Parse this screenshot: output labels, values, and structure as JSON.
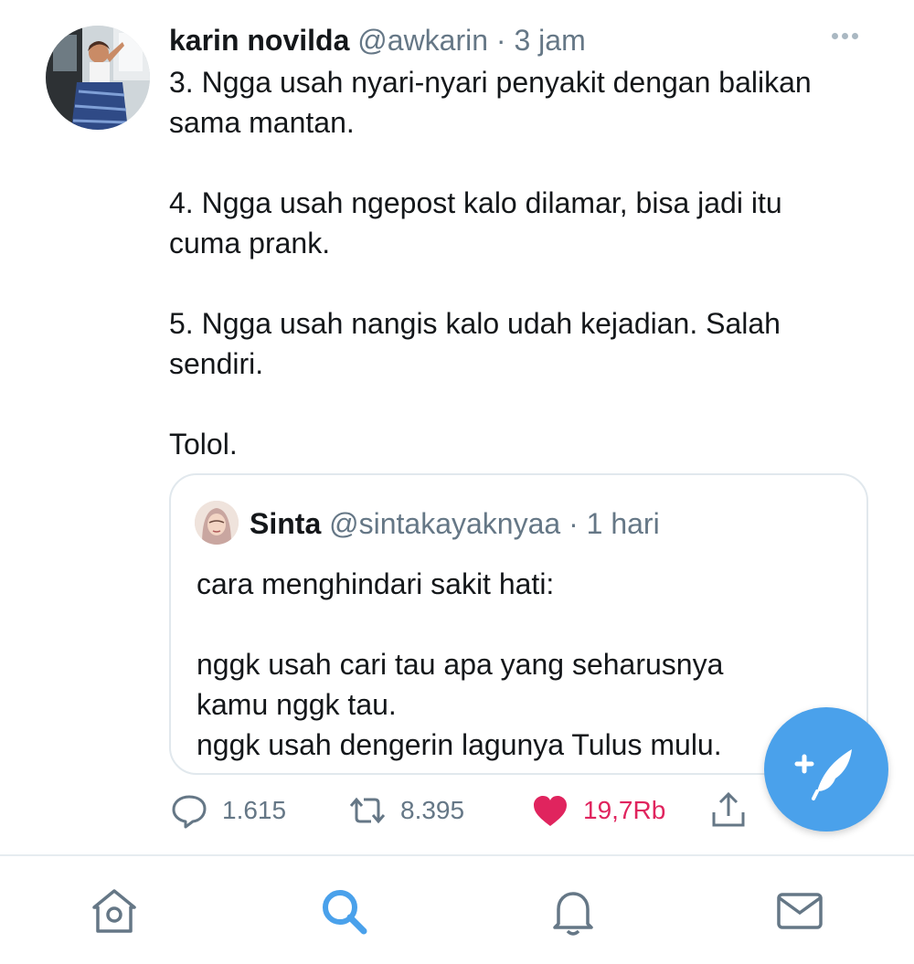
{
  "tweet": {
    "name": "karin novilda",
    "handle": "@awkarin",
    "separator": "·",
    "time": "3 jam",
    "paragraphs": [
      "3. Ngga usah nyari-nyari penyakit dengan balikan\nsama mantan.",
      "4. Ngga usah ngepost kalo dilamar, bisa jadi itu\ncuma prank.",
      "5. Ngga usah nangis kalo udah kejadian. Salah\nsendiri.",
      "Tolol."
    ],
    "more_icon": "more-horizontal-icon"
  },
  "quoted": {
    "name": "Sinta",
    "handle": "@sintakayaknyaa",
    "separator": "·",
    "time": "1 hari",
    "paragraphs": [
      "cara menghindari sakit hati:",
      "nggk usah cari tau apa yang seharusnya\nkamu nggk tau.\nnggk usah dengerin lagunya Tulus mulu."
    ]
  },
  "actions": {
    "replies": "1.615",
    "retweets": "8.395",
    "likes": "19,7Rb",
    "liked": true
  },
  "colors": {
    "accent": "#4aa1eb",
    "like": "#e0245e",
    "muted": "#657786",
    "border": "#e1e8ed"
  },
  "tabs": [
    "home-icon",
    "search-icon",
    "notifications-icon",
    "messages-icon"
  ],
  "active_tab": "search-icon"
}
